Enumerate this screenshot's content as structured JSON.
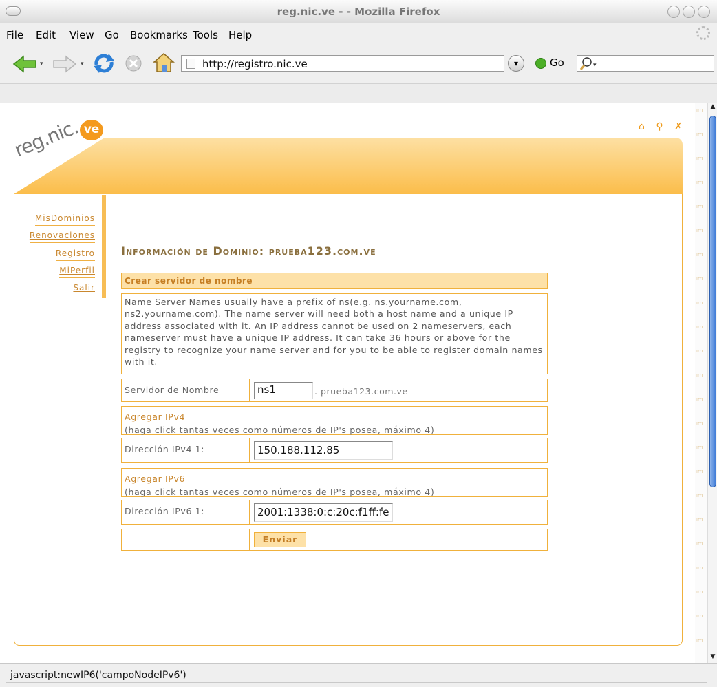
{
  "window": {
    "title": "reg.nic.ve - - Mozilla Firefox"
  },
  "menu": {
    "file": "File",
    "edit": "Edit",
    "view": "View",
    "go": "Go",
    "bookmarks": "Bookmarks",
    "tools": "Tools",
    "help": "Help"
  },
  "toolbar": {
    "url": "http://registro.nic.ve",
    "go_label": "Go",
    "icons": [
      "back-arrow-icon",
      "forward-arrow-icon",
      "reload-icon",
      "stop-icon",
      "home-icon",
      "search-icon"
    ]
  },
  "site": {
    "logo_text": "reg.nic.",
    "logo_badge": "ve",
    "top_icons": "⌂ ♀ ✗",
    "accent_color": "#f0b13c",
    "banner_color": "#fbbd4a"
  },
  "sidebar": {
    "items": [
      "MisDominios",
      "Renovaciones",
      "Registro",
      "MiPerfil",
      "Salir"
    ]
  },
  "page": {
    "title_prefix": "Información de Dominio: prueba123.com.ve"
  },
  "form": {
    "header": "Crear servidor de nombre",
    "description": "Name Server Names usually have a prefix of ns(e.g. ns.yourname.com, ns2.yourname.com). The name server will need both a host name and a unique IP address associated with it. An IP address cannot be used on 2 nameservers, each nameserver must have a unique IP address. It can take 36 hours or above for the registry to recognize your name server and for you to be able to register domain names with it.",
    "server_label": "Servidor de Nombre",
    "server_value": "ns1",
    "server_suffix": ". prueba123.com.ve",
    "add_ipv4_link": "Agregar IPv4",
    "add_ipv4_hint": "(haga click tantas veces como números de IP's posea, máximo 4)",
    "ipv4_label": "Dirección IPv4 1:",
    "ipv4_value": "150.188.112.85",
    "add_ipv6_link": "Agregar IPv6",
    "add_ipv6_hint": "(haga click tantas veces como números de IP's posea, máximo 4)",
    "ipv6_label": "Dirección IPv6 1:",
    "ipv6_value": "2001:1338:0:c:20c:f1ff:fe",
    "submit": "Enviar"
  },
  "status": {
    "text": "javascript:newIP6('campoNodeIPv6')"
  }
}
